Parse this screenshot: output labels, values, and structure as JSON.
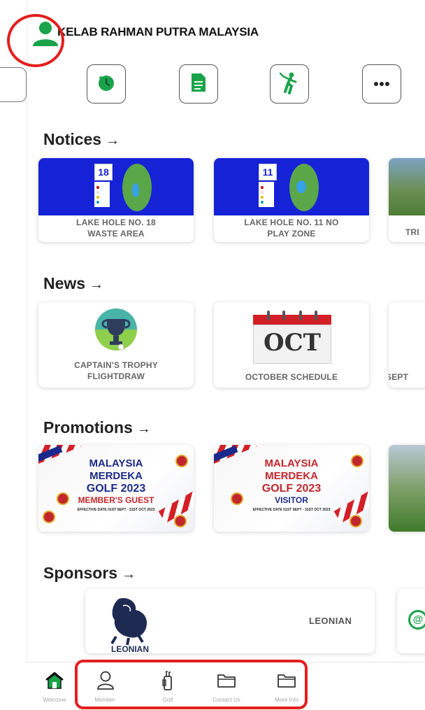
{
  "header": {
    "title": "KELAB RAHMAN PUTRA MALAYSIA",
    "avatar_icon": "user-icon"
  },
  "quick_actions": [
    {
      "name": "history-icon"
    },
    {
      "name": "document-icon"
    },
    {
      "name": "golfer-icon"
    },
    {
      "name": "more-icon"
    }
  ],
  "sections": {
    "notices": {
      "title": "Notices",
      "arrow": "→"
    },
    "news": {
      "title": "News",
      "arrow": "→"
    },
    "promotions": {
      "title": "Promotions",
      "arrow": "→"
    },
    "sponsors": {
      "title": "Sponsors",
      "arrow": "→"
    }
  },
  "notices": [
    {
      "line1": "LAKE HOLE NO. 18",
      "line2": "WASTE AREA",
      "hole": "18"
    },
    {
      "line1": "LAKE HOLE NO. 11 NO",
      "line2": "PLAY ZONE",
      "hole": "11"
    },
    {
      "line1": "TRI",
      "line2": ""
    }
  ],
  "news": [
    {
      "line1": "CAPTAIN'S TROPHY",
      "line2": "FLIGHTDRAW"
    },
    {
      "line1": "OCTOBER SCHEDULE",
      "line2": "",
      "calendar": "OCT"
    },
    {
      "line1": "SEPT",
      "line2": ""
    }
  ],
  "promotions": [
    {
      "l1": "MALAYSIA",
      "l2": "MERDEKA",
      "l3": "GOLF 2023",
      "l4": "MEMBER'S GUEST",
      "l5": "EFFECTIVE DATE 01ST SEPT - 31ST OCT 2023"
    },
    {
      "l1": "MALAYSIA",
      "l2": "MERDEKA",
      "l3": "GOLF 2023",
      "l4": "VISITOR",
      "l5": "EFFECTIVE DATE 01ST SEPT - 31ST OCT 2023"
    }
  ],
  "sponsors": [
    {
      "label": "LEONIAN",
      "logo_text": "LEONIAN"
    }
  ],
  "bottom_nav": [
    {
      "label": "Welcome",
      "icon": "home-icon",
      "active": true
    },
    {
      "label": "Member",
      "icon": "member-icon"
    },
    {
      "label": "Golf",
      "icon": "golf-bag-icon"
    },
    {
      "label": "Contact Us",
      "icon": "folder-icon"
    },
    {
      "label": "More Info",
      "icon": "folder-icon"
    }
  ],
  "colors": {
    "brand_green": "#1aa34a",
    "annotation_red": "#e31e1e",
    "notice_blue": "#1522d6"
  }
}
